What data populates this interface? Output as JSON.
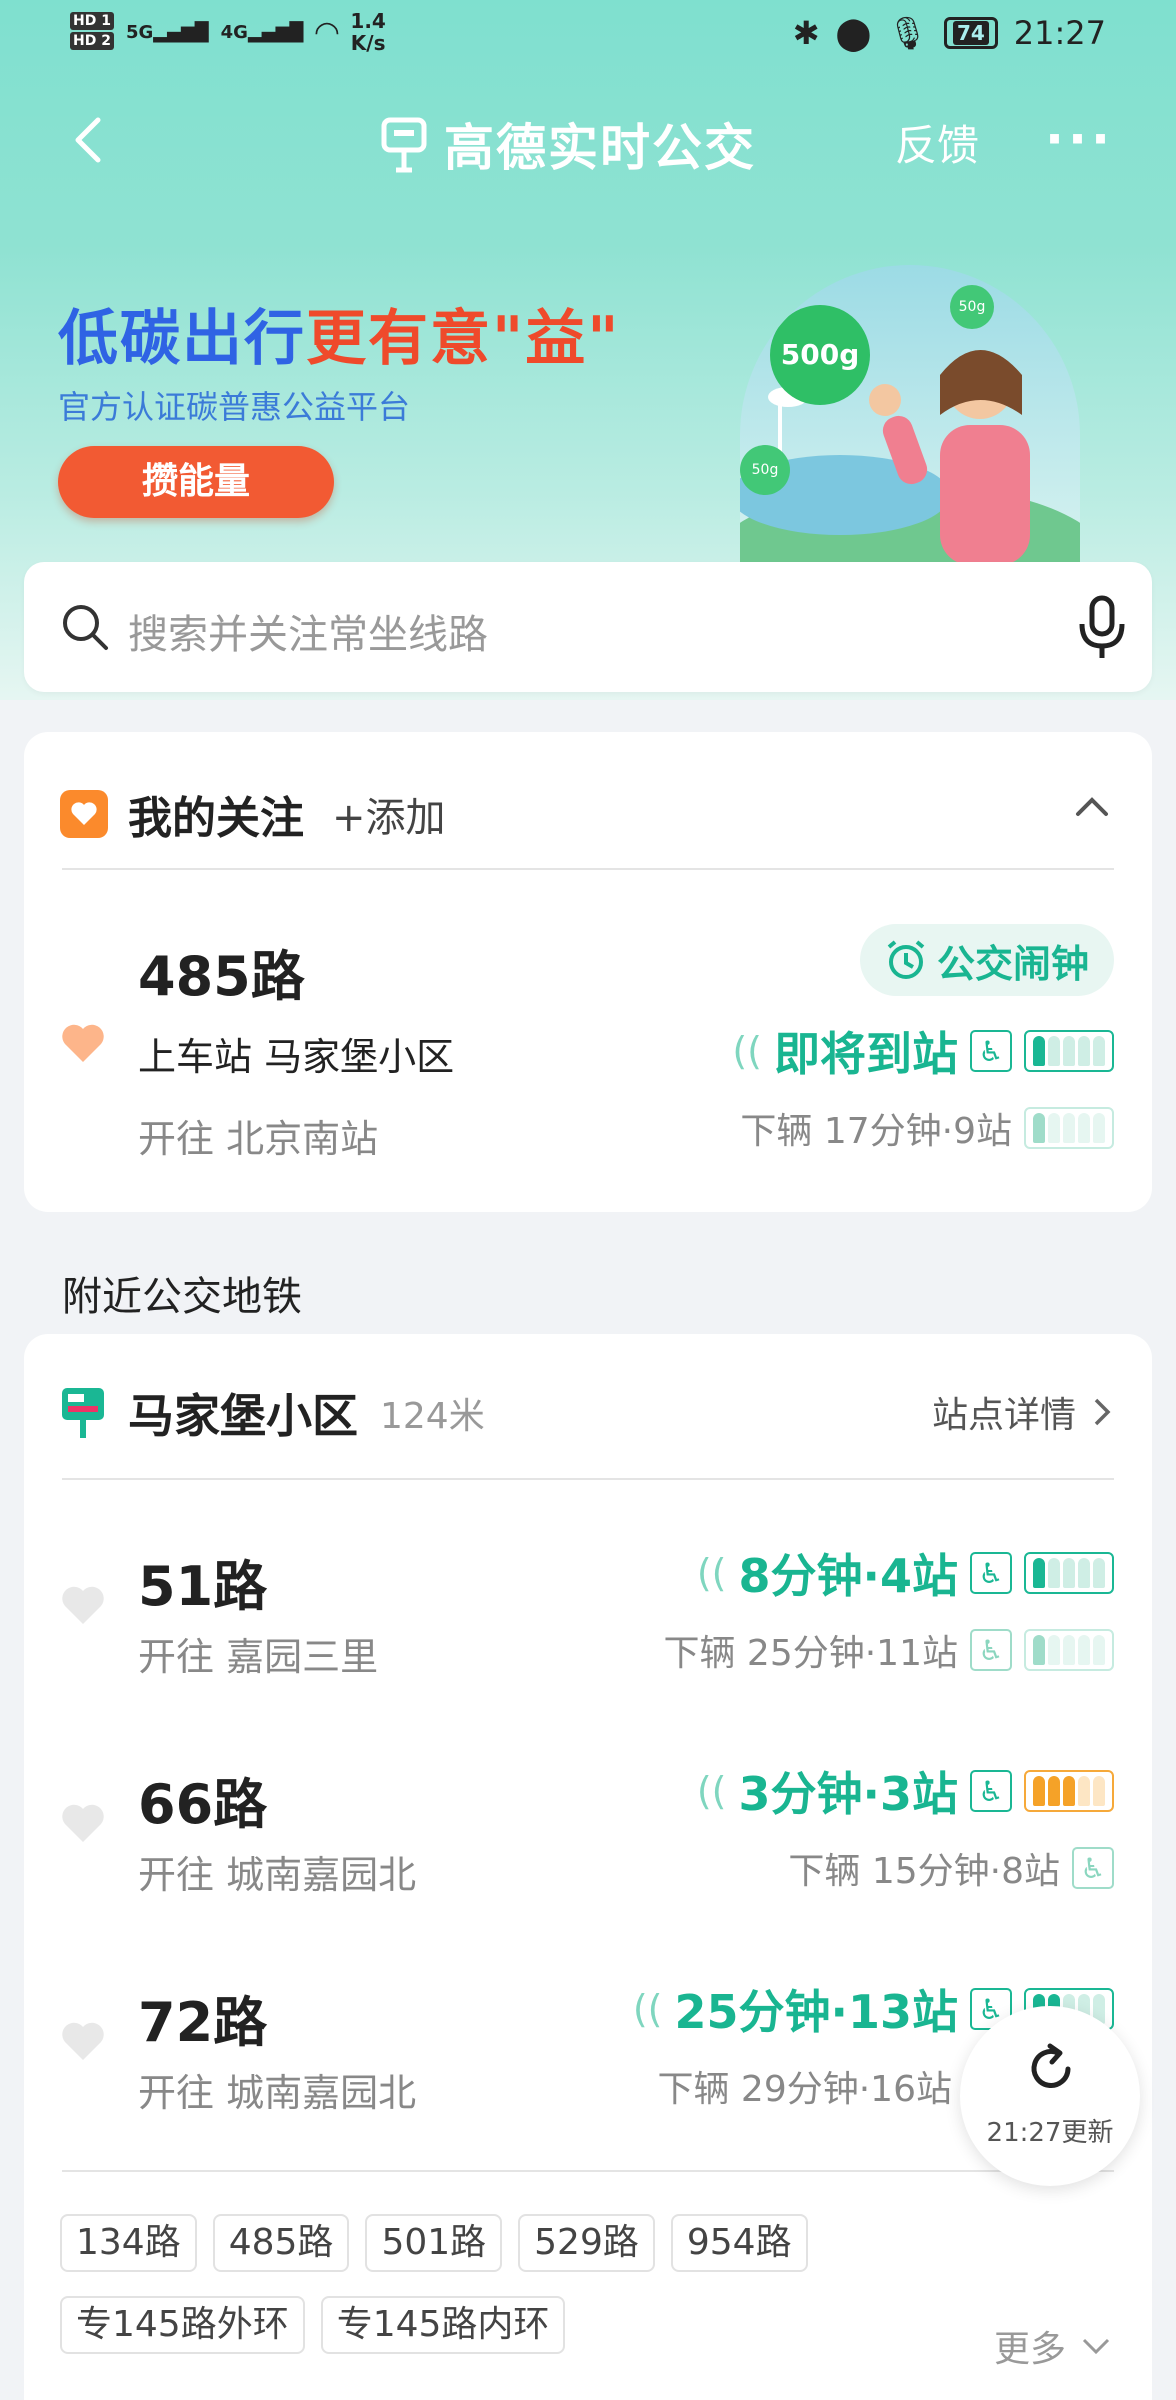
{
  "status_bar": {
    "hd1": "HD 1",
    "hd2": "HD 2",
    "net1": "5G",
    "net2": "4G",
    "speed_value": "1.4",
    "speed_unit": "K/s",
    "battery": "74",
    "time": "21:27"
  },
  "nav": {
    "title": "高德实时公交",
    "feedback": "反馈",
    "more": "···"
  },
  "banner": {
    "title_part1": "低碳出行",
    "title_part2": "更有意\"益\"",
    "subtitle": "官方认证碳普惠公益平台",
    "button": "攒能量",
    "badge_big": "500g",
    "badge_small": "50g"
  },
  "search": {
    "placeholder": "搜索并关注常坐线路"
  },
  "follow": {
    "title": "我的关注",
    "add_label": "+添加",
    "route": {
      "name": "485路",
      "boarding": "上车站 马家堡小区",
      "direction": "开往 北京南站",
      "alarm_label": "公交闹钟",
      "arrival": "即将到站",
      "next": "下辆 17分钟·9站"
    }
  },
  "nearby": {
    "section_title": "附近公交地铁",
    "stop": {
      "name": "马家堡小区",
      "distance": "124米",
      "detail_label": "站点详情"
    },
    "routes": [
      {
        "name": "51路",
        "direction": "开往 嘉园三里",
        "arrival": "8分钟·4站",
        "next": "下辆 25分钟·11站"
      },
      {
        "name": "66路",
        "direction": "开往 城南嘉园北",
        "arrival": "3分钟·3站",
        "next": "下辆 15分钟·8站"
      },
      {
        "name": "72路",
        "direction": "开往 城南嘉园北",
        "arrival": "25分钟·13站",
        "next": "下辆 29分钟·16站"
      }
    ],
    "chips_row1": [
      "134路",
      "485路",
      "501路",
      "529路",
      "954路"
    ],
    "chips_row2": [
      "专145路外环",
      "专145路内环"
    ],
    "more_label": "更多"
  },
  "refresh": {
    "label": "21:27更新"
  },
  "colors": {
    "accent_green": "#19b591",
    "banner_red": "#ef4a2b",
    "banner_blue": "#2f63e4",
    "orange": "#fb8a2c"
  }
}
